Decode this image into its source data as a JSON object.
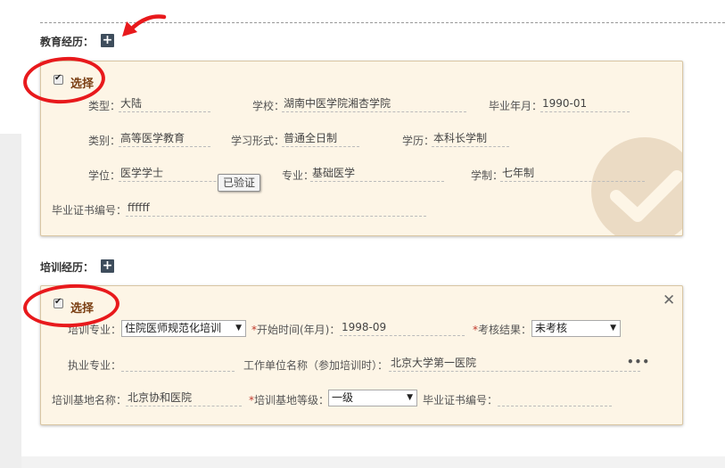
{
  "education": {
    "title": "教育经历：",
    "select_label": "选择",
    "fields": {
      "type": {
        "label": "类型：",
        "value": "大陆"
      },
      "school": {
        "label": "学校：",
        "value": "湖南中医学院湘杏学院"
      },
      "grad_date": {
        "label": "毕业年月：",
        "value": "1990-01"
      },
      "category": {
        "label": "类别：",
        "value": "高等医学教育"
      },
      "study_form": {
        "label": "学习形式：",
        "value": "普通全日制"
      },
      "edu_level": {
        "label": "学历：",
        "value": "本科长学制"
      },
      "degree": {
        "label": "学位：",
        "value": "医学学士"
      },
      "major": {
        "label": "专业：",
        "value": "基础医学"
      },
      "duration": {
        "label": "学制：",
        "value": "七年制"
      },
      "cert_no": {
        "label": "毕业证书编号：",
        "value": "ffffff"
      }
    },
    "verified_badge": "已验证"
  },
  "training": {
    "title": "培训经历：",
    "select_label": "选择",
    "fields": {
      "specialty": {
        "label": "培训专业：",
        "value": "住院医师规范化培训"
      },
      "start_time": {
        "req": "*",
        "label": "开始时间(年月)：",
        "value": "1998-09"
      },
      "result": {
        "req": "*",
        "label": "考核结果：",
        "value": "未考核"
      },
      "practice_major": {
        "label": "执业专业：",
        "value": ""
      },
      "work_unit": {
        "label": "工作单位名称（参加培训时）：",
        "value": "北京大学第一医院"
      },
      "base_name": {
        "label": "培训基地名称：",
        "value": "北京协和医院"
      },
      "base_level": {
        "req": "*",
        "label": "培训基地等级：",
        "value": "一级"
      },
      "cert_no": {
        "label": "毕业证书编号：",
        "value": ""
      }
    },
    "more": "•••",
    "close": "✕"
  },
  "icons": {
    "plus": "+",
    "dropdown_arrow": "▼"
  },
  "colors": {
    "panel_bg": "#fdf5e6",
    "annotation_red": "#e8191c",
    "select_label": "#7a3e12",
    "plus_button": "#3e4d5c"
  }
}
